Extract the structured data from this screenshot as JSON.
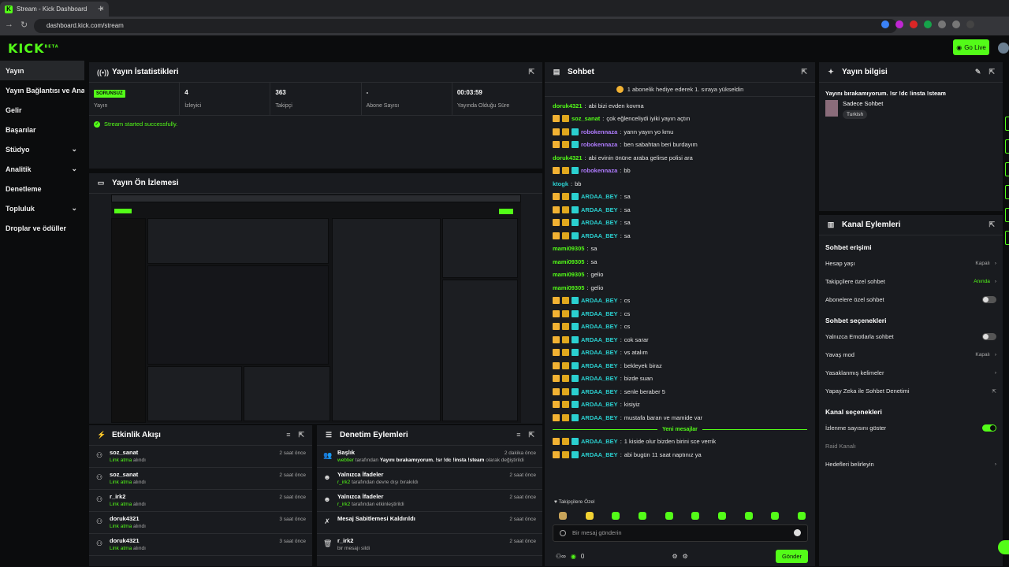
{
  "browser": {
    "tab_title": "Stream - Kick Dashboard",
    "url": "dashboard.kick.com/stream"
  },
  "app": {
    "logo": "KICK",
    "logo_sup": "BETA",
    "go_live": "Go Live"
  },
  "sidebar": {
    "items": [
      {
        "label": "Yayın"
      },
      {
        "label": "Yayın Bağlantısı ve Anahtarı"
      },
      {
        "label": "Gelir"
      },
      {
        "label": "Başarılar"
      },
      {
        "label": "Stüdyo"
      },
      {
        "label": "Analitik"
      },
      {
        "label": "Denetleme"
      },
      {
        "label": "Topluluk"
      },
      {
        "label": "Droplar ve ödüller"
      }
    ]
  },
  "stats": {
    "title": "Yayın İstatistikleri",
    "status_badge": "SORUNSUZ",
    "status_label": "Yayın",
    "viewers": "4",
    "viewers_label": "İzleyici",
    "followers": "363",
    "followers_label": "Takipçi",
    "subs": "-",
    "subs_label": "Abone Sayısı",
    "uptime": "00:03:59",
    "uptime_label": "Yayında Olduğu Süre",
    "message": "Stream started successfully."
  },
  "preview": {
    "title": "Yayın Ön İzlemesi"
  },
  "activity": {
    "title": "Etkinlik Akışı",
    "items": [
      {
        "user": "soz_sanat",
        "action": "Link atma",
        "suffix": " alındı",
        "time": "2 saat önce"
      },
      {
        "user": "soz_sanat",
        "action": "Link atma",
        "suffix": " alındı",
        "time": "2 saat önce"
      },
      {
        "user": "r_irk2",
        "action": "Link atma",
        "suffix": " alındı",
        "time": "2 saat önce"
      },
      {
        "user": "doruk4321",
        "action": "Link atma",
        "suffix": " alındı",
        "time": "3 saat önce"
      },
      {
        "user": "doruk4321",
        "action": "Link atma",
        "suffix": " alındı",
        "time": "3 saat önce"
      }
    ]
  },
  "modlog": {
    "title": "Denetim Eylemleri",
    "items": [
      {
        "title": "Başlık",
        "actor": "webtier",
        "mid": " tarafından ",
        "detail": "Yayını bırakamıyorum. !sr !dc !insta !steam",
        "end": " olarak değiştirildi",
        "time": "2 dakika önce"
      },
      {
        "title": "Yalnızca İfadeler",
        "actor": "r_irk2",
        "mid": " tarafından devre dışı bırakıldı",
        "detail": "",
        "end": "",
        "time": "2 saat önce"
      },
      {
        "title": "Yalnızca İfadeler",
        "actor": "r_irk2",
        "mid": " tarafından etkinleştirildi",
        "detail": "",
        "end": "",
        "time": "2 saat önce"
      },
      {
        "title": "Mesaj Sabitlemesi Kaldırıldı",
        "actor": "",
        "mid": "",
        "detail": "",
        "end": "",
        "time": "2 saat önce"
      },
      {
        "title": "r_irk2",
        "actor": "",
        "mid": "bir mesajı sildi",
        "detail": "",
        "end": "",
        "time": "2 saat önce"
      }
    ]
  },
  "chat": {
    "title": "Sohbet",
    "pinned": "1 abonelik hediye ederek 1. sıraya yükseldin",
    "messages": [
      {
        "user": "doruk4321",
        "text": "abi bizi evden kovma",
        "color": "#53fc18",
        "badges": 0
      },
      {
        "user": "soz_sanat",
        "text": "çok eğlenceliydi iyiki yayın açtın",
        "color": "#53fc18",
        "badges": 2
      },
      {
        "user": "robokennaza",
        "text": "yarın yayın yo kmu",
        "color": "#b07cff",
        "badges": 3
      },
      {
        "user": "robokennaza",
        "text": "ben sabahtan beri burdayım",
        "color": "#b07cff",
        "badges": 3
      },
      {
        "user": "doruk4321",
        "text": "abi evinin önüne araba gelirse polisi ara",
        "color": "#53fc18",
        "badges": 0
      },
      {
        "user": "robokennaza",
        "text": "bb",
        "color": "#b07cff",
        "badges": 3
      },
      {
        "user": "ktogk",
        "text": "bb",
        "color": "#2bd0d0",
        "badges": 0
      },
      {
        "user": "ARDAA_BEY",
        "text": "sa",
        "color": "#2bd0d0",
        "badges": 3
      },
      {
        "user": "ARDAA_BEY",
        "text": "sa",
        "color": "#2bd0d0",
        "badges": 3
      },
      {
        "user": "ARDAA_BEY",
        "text": "sa",
        "color": "#2bd0d0",
        "badges": 3
      },
      {
        "user": "ARDAA_BEY",
        "text": "sa",
        "color": "#2bd0d0",
        "badges": 3
      },
      {
        "user": "mami09305",
        "text": "sa",
        "color": "#53fc18",
        "badges": 0
      },
      {
        "user": "mami09305",
        "text": "sa",
        "color": "#53fc18",
        "badges": 0
      },
      {
        "user": "mami09305",
        "text": "gelio",
        "color": "#53fc18",
        "badges": 0
      },
      {
        "user": "mami09305",
        "text": "gelio",
        "color": "#53fc18",
        "badges": 0
      },
      {
        "user": "ARDAA_BEY",
        "text": "cs",
        "color": "#2bd0d0",
        "badges": 3
      },
      {
        "user": "ARDAA_BEY",
        "text": "cs",
        "color": "#2bd0d0",
        "badges": 3
      },
      {
        "user": "ARDAA_BEY",
        "text": "cs",
        "color": "#2bd0d0",
        "badges": 3
      },
      {
        "user": "ARDAA_BEY",
        "text": "cok sarar",
        "color": "#2bd0d0",
        "badges": 3
      },
      {
        "user": "ARDAA_BEY",
        "text": "vs atalım",
        "color": "#2bd0d0",
        "badges": 3
      },
      {
        "user": "ARDAA_BEY",
        "text": "bekleyek biraz",
        "color": "#2bd0d0",
        "badges": 3
      },
      {
        "user": "ARDAA_BEY",
        "text": "bizde suan",
        "color": "#2bd0d0",
        "badges": 3
      },
      {
        "user": "ARDAA_BEY",
        "text": "senle beraber 5",
        "color": "#2bd0d0",
        "badges": 3
      },
      {
        "user": "ARDAA_BEY",
        "text": "kisiyiz",
        "color": "#2bd0d0",
        "badges": 3
      },
      {
        "user": "ARDAA_BEY",
        "text": "mustafa baran ve mamide var",
        "color": "#2bd0d0",
        "badges": 3
      }
    ],
    "new_messages_label": "Yeni mesajlar",
    "new_messages": [
      {
        "user": "ARDAA_BEY",
        "text": "1 kiside olur bizden birini sce verrik",
        "color": "#2bd0d0",
        "badges": 3
      },
      {
        "user": "ARDAA_BEY",
        "text": "abi bugün 11 saat naptınız ya",
        "color": "#2bd0d0",
        "badges": 3
      }
    ],
    "follower_only": "Takipçilere Özel",
    "placeholder": "Bir mesaj gönderin",
    "points": "0",
    "send": "Gönder"
  },
  "info": {
    "title": "Yayın bilgisi",
    "stream_title": "Yayını bırakamıyorum. !sr !dc !insta !steam",
    "category": "Sadece Sohbet",
    "language": "Turkish"
  },
  "actions": {
    "title": "Kanal Eylemleri",
    "chat_access": "Sohbet erişimi",
    "account_age": "Hesap yaşı",
    "account_age_val": "Kapalı",
    "followers_only": "Takipçilere özel sohbet",
    "followers_only_val": "Anında",
    "subs_only": "Abonelere özel sohbet",
    "chat_options": "Sohbet seçenekleri",
    "emotes_only": "Yalnızca Emotlarla sohbet",
    "slow_mode": "Yavaş mod",
    "slow_mode_val": "Kapalı",
    "banned_words": "Yasaklanmış kelimeler",
    "ai_mod": "Yapay Zeka ile Sohbet Denetimi",
    "channel_options": "Kanal seçenekleri",
    "show_viewers": "İzlenme sayısını göster",
    "raid_channel": "Raid Kanalı",
    "set_goals": "Hedefleri belirleyin"
  }
}
